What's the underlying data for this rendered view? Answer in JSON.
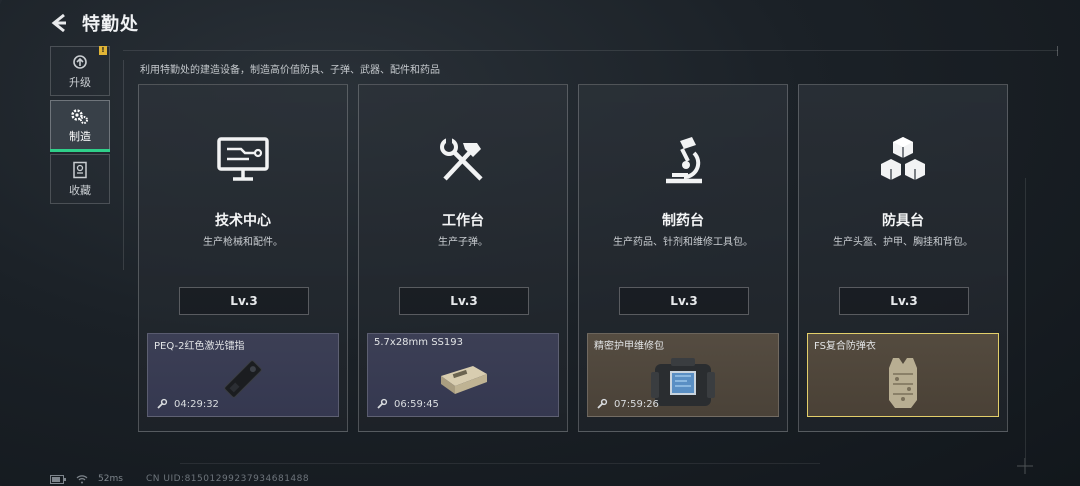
{
  "header": {
    "title": "特勤处"
  },
  "side_nav": [
    {
      "label": "升级",
      "icon": "upgrade-icon",
      "badge": "!"
    },
    {
      "label": "制造",
      "icon": "gears-icon",
      "active": true
    },
    {
      "label": "收藏",
      "icon": "collection-icon"
    }
  ],
  "subtitle": "利用特勤处的建造设备，制造高价值防具、子弹、武器、配件和药品",
  "cards": [
    {
      "name": "技术中心",
      "desc": "生产枪械和配件。",
      "level": "Lv.3",
      "icon": "monitor-circuit-icon",
      "item": {
        "name": "PEQ-2红色激光镭指",
        "timer": "04:29:32",
        "image": "laser-device-image"
      }
    },
    {
      "name": "工作台",
      "desc": "生产子弹。",
      "level": "Lv.3",
      "icon": "hammer-wrench-icon",
      "item": {
        "name": "5.7x28mm SS193",
        "timer": "06:59:45",
        "image": "ammo-box-image"
      }
    },
    {
      "name": "制药台",
      "desc": "生产药品、针剂和维修工具包。",
      "level": "Lv.3",
      "icon": "microscope-icon",
      "item": {
        "name": "精密护甲维修包",
        "timer": "07:59:26",
        "image": "repair-kit-image"
      }
    },
    {
      "name": "防具台",
      "desc": "生产头盔、护甲、胸挂和背包。",
      "level": "Lv.3",
      "icon": "cubes-icon",
      "item": {
        "name": "FS复合防弹衣",
        "timer": "",
        "image": "body-armor-image"
      }
    }
  ],
  "footer": {
    "ping": "52ms",
    "uid": "CN UID:815012992379346814​88"
  },
  "colors": {
    "accent_green": "#2fd08a",
    "badge_yellow": "#e1b536",
    "gold_border": "#e3cf6a"
  }
}
